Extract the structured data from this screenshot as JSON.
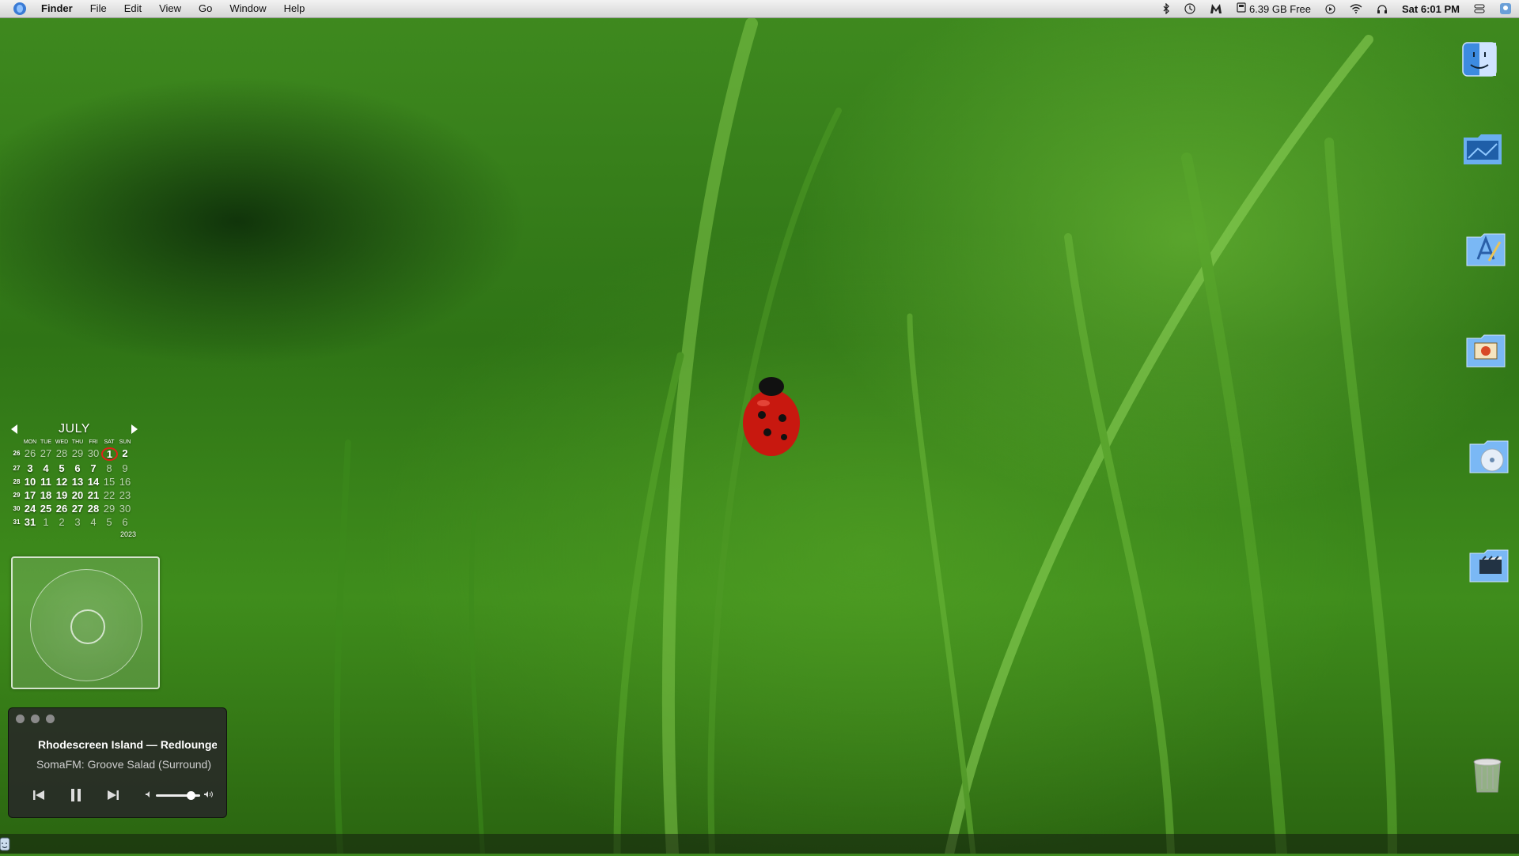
{
  "menubar": {
    "app_name": "Finder",
    "menus": [
      "File",
      "Edit",
      "View",
      "Go",
      "Window",
      "Help"
    ],
    "status": {
      "disk_free": "6.39 GB Free",
      "clock": "Sat 6:01 PM"
    },
    "icons": [
      "apple-icon",
      "bluetooth-icon",
      "timemachine-icon",
      "malwarebytes-icon",
      "disk-icon",
      "play-icon",
      "wifi-icon",
      "headphones-icon",
      "control-center-icon",
      "user-icon"
    ]
  },
  "desktop_icons": [
    {
      "name": "finder-icon"
    },
    {
      "name": "desktop-folder-icon"
    },
    {
      "name": "applications-folder-icon"
    },
    {
      "name": "pictures-folder-icon"
    },
    {
      "name": "music-folder-icon"
    },
    {
      "name": "movies-folder-icon"
    },
    {
      "name": "trash-icon"
    }
  ],
  "calendar": {
    "month": "JULY",
    "weekday_headers": [
      "MON",
      "TUE",
      "WED",
      "THU",
      "FRI",
      "SAT",
      "SUN"
    ],
    "weeks": [
      {
        "wk": "26",
        "days": [
          "26",
          "27",
          "28",
          "29",
          "30",
          "1",
          "2"
        ]
      },
      {
        "wk": "27",
        "days": [
          "3",
          "4",
          "5",
          "6",
          "7",
          "8",
          "9"
        ]
      },
      {
        "wk": "28",
        "days": [
          "10",
          "11",
          "12",
          "13",
          "14",
          "15",
          "16"
        ]
      },
      {
        "wk": "29",
        "days": [
          "17",
          "18",
          "19",
          "20",
          "21",
          "22",
          "23"
        ]
      },
      {
        "wk": "30",
        "days": [
          "24",
          "25",
          "26",
          "27",
          "28",
          "29",
          "30"
        ]
      },
      {
        "wk": "31",
        "days": [
          "31",
          "1",
          "2",
          "3",
          "4",
          "5",
          "6"
        ]
      }
    ],
    "today": "1",
    "year": "2023"
  },
  "player": {
    "title": "Rhodescreen Island — Redlounge",
    "subtitle": "SomaFM: Groove Salad (Surround)",
    "volume": 0.8
  }
}
